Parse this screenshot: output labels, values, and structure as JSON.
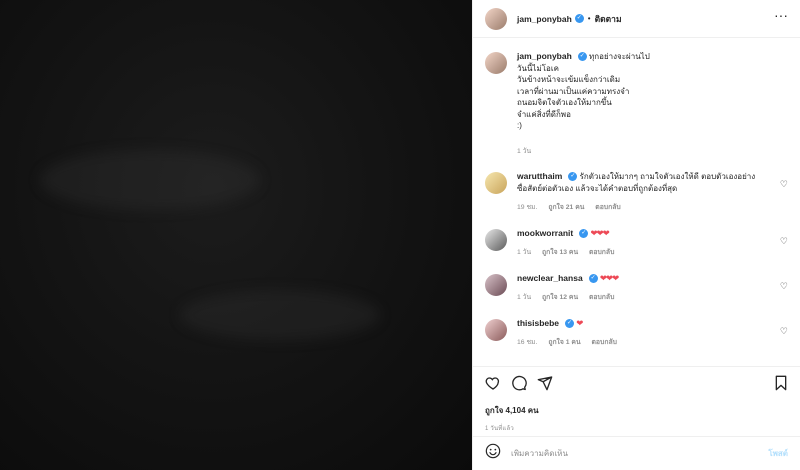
{
  "post": {
    "username": "jam_ponybah",
    "follow_label": "ติดตาม",
    "more_label": "···"
  },
  "caption": {
    "username": "jam_ponybah",
    "lines": [
      "ทุกอย่างจะผ่านไป",
      "วันนี้ไม่โอเค",
      "วันข้างหน้าจะเข้มแข็งกว่าเดิม",
      "เวลาที่ผ่านมาเป็นแค่ความทรงจำ",
      "ถนอมจิตใจตัวเองให้มากขึ้น",
      "จำแค่สิ่งที่ดีก็พอ",
      ":)"
    ],
    "time": "1 วัน"
  },
  "comments": [
    {
      "username": "warutthaim",
      "text": "รักตัวเองให้มากๆ ถามใจตัวเองให้ดี ตอบตัวเองอย่างซื่อสัตย์ต่อตัวเอง แล้วจะได้คำตอบที่ถูกต้องที่สุด",
      "time": "19 ชม.",
      "likes": "ถูกใจ 21 คน",
      "reply": "ตอบกลับ"
    },
    {
      "username": "mookworranit",
      "text": "❤❤❤",
      "time": "1 วัน",
      "likes": "ถูกใจ 13 คน",
      "reply": "ตอบกลับ"
    },
    {
      "username": "newclear_hansa",
      "text": "❤❤❤",
      "time": "1 วัน",
      "likes": "ถูกใจ 12 คน",
      "reply": "ตอบกลับ"
    },
    {
      "username": "thisisbebe",
      "text": "❤",
      "time": "16 ชม.",
      "likes": "ถูกใจ 1 คน",
      "reply": "ตอบกลับ"
    }
  ],
  "stats": {
    "likes": "ถูกใจ 4,104 คน",
    "posted": "1 วันที่แล้ว"
  },
  "add_comment": {
    "placeholder": "เพิ่มความคิดเห็น",
    "post_label": "โพสต์"
  },
  "colors": {
    "verified": "#3897f0",
    "heart": "#ed4956",
    "post_button": "#b2dffc"
  }
}
